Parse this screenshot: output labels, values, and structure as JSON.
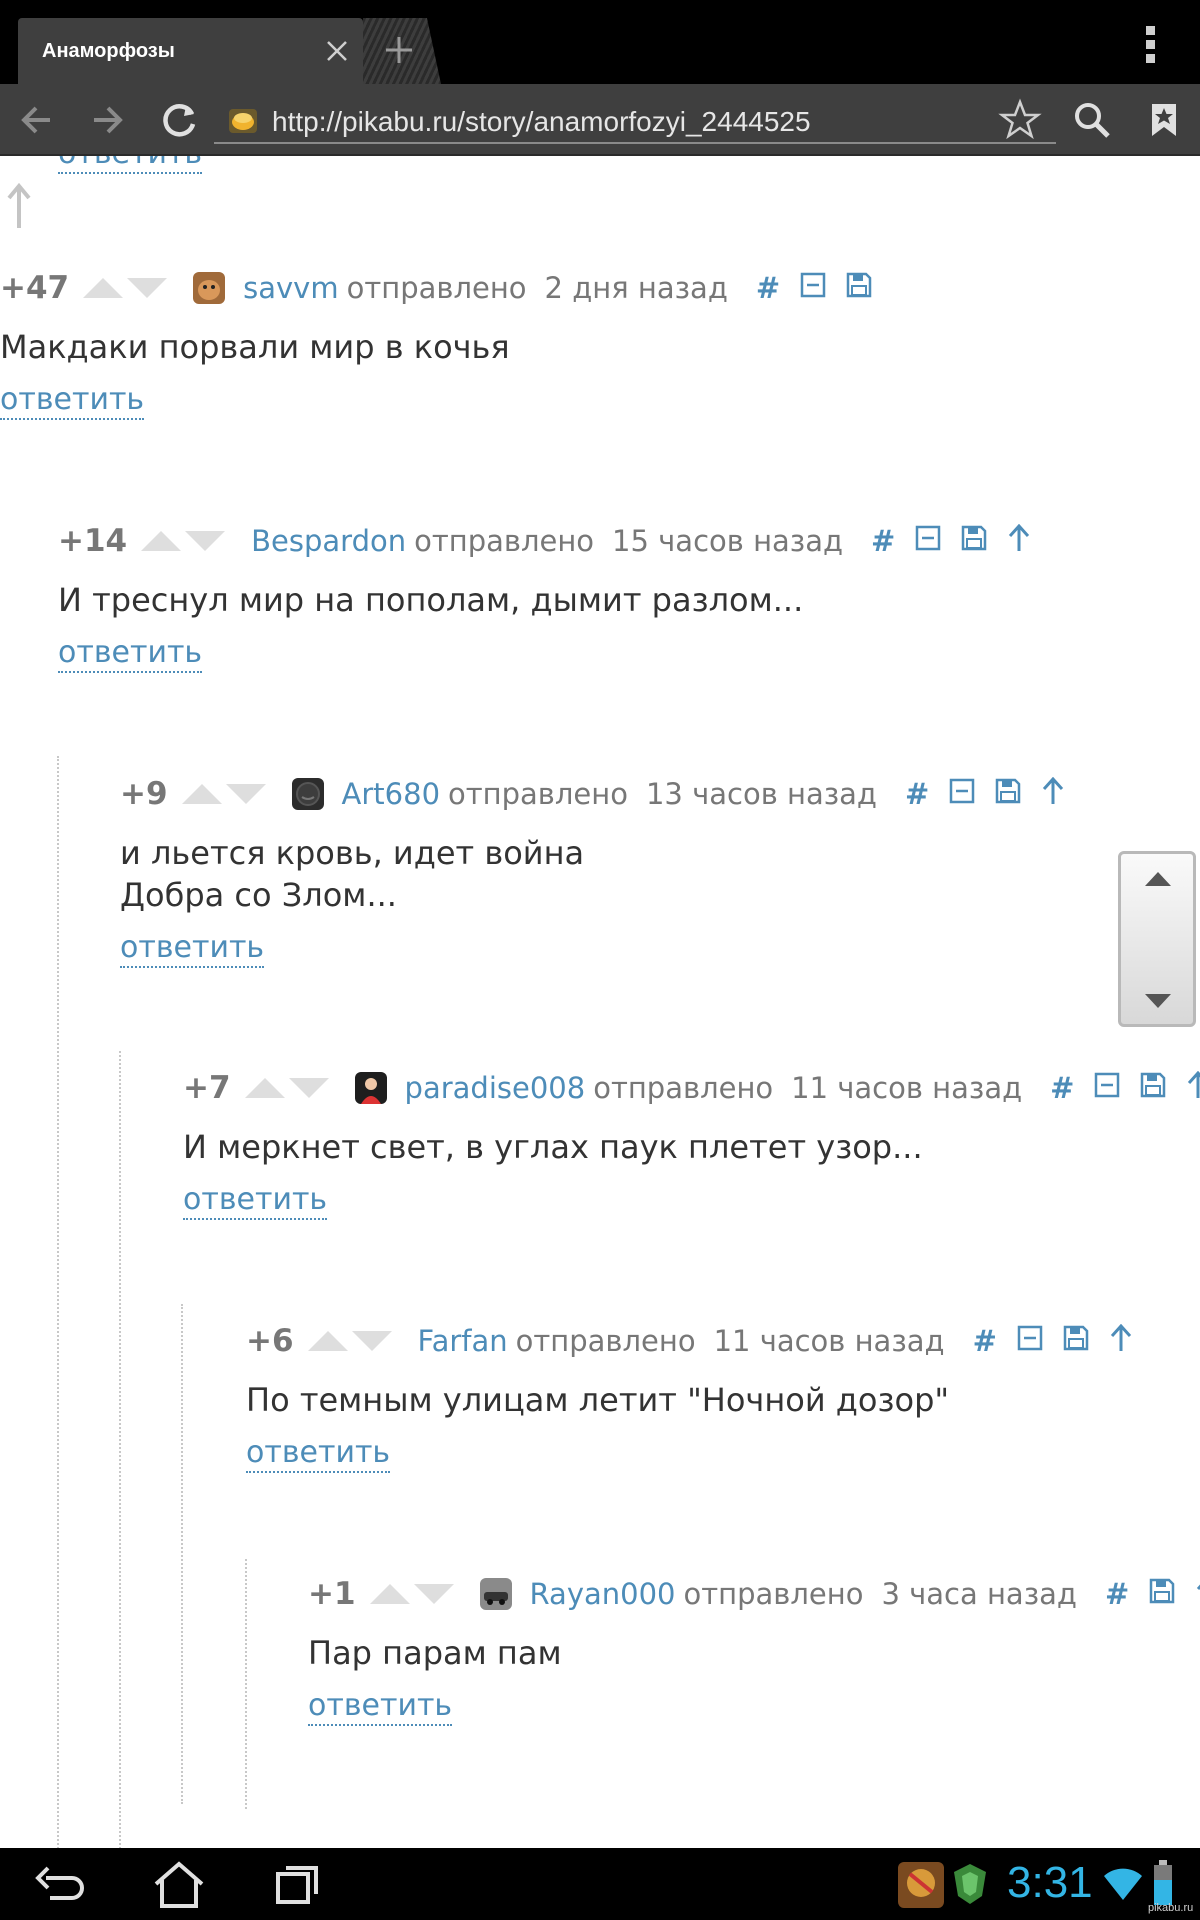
{
  "browser": {
    "tab_title": "Анаморфозы",
    "url": "http://pikabu.ru/story/anamorfozyi_2444525"
  },
  "common": {
    "sent_label": "отправлено",
    "reply_label": "ответить",
    "hash_label": "#"
  },
  "comments": [
    {
      "score": "+47",
      "user": "savvm",
      "time": "2 дня назад",
      "text": "Макдаки порвали мир в кочья",
      "avatar": "dog-avatar"
    },
    {
      "score": "+14",
      "user": "Bespardon",
      "time": "15 часов назад",
      "text": "И треснул мир на пополам, дымит разлом...",
      "avatar": "none"
    },
    {
      "score": "+9",
      "user": "Art680",
      "time": "13 часов назад",
      "text_lines": [
        "и льется кровь, идет война",
        "Добра со Злом..."
      ],
      "avatar": "dark-face-avatar"
    },
    {
      "score": "+7",
      "user": "paradise008",
      "time": "11 часов назад",
      "text": "И меркнет свет, в углах паук плетет узор...",
      "avatar": "person-avatar"
    },
    {
      "score": "+6",
      "user": "Farfan",
      "time": "11 часов назад",
      "text": "По темным улицам летит \"Ночной дозор\"",
      "avatar": "none"
    },
    {
      "score": "+1",
      "user": "Rayan000",
      "time": "3 часа назад",
      "text": "Пар парам пам",
      "avatar": "car-avatar"
    }
  ],
  "status": {
    "time": "3:31",
    "watermark": "pikabu.ru"
  },
  "colors": {
    "link": "#4d8cb8",
    "meta": "#777777",
    "clock": "#33b5e5",
    "toolbar": "#3f3f3f"
  }
}
